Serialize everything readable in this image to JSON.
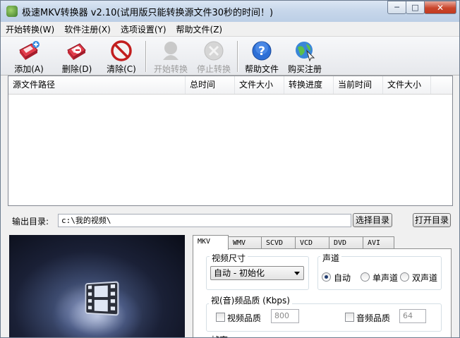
{
  "window": {
    "title": "极速MKV转换器 v2.10(试用版只能转换源文件30秒的时间！)",
    "min_glyph": "─",
    "max_glyph": "□",
    "close_glyph": "✕"
  },
  "menu": [
    "开始转换(W)",
    "软件注册(X)",
    "选项设置(Y)",
    "帮助文件(Z)"
  ],
  "toolbar": {
    "add": "添加(A)",
    "delete": "删除(D)",
    "clear": "清除(C)",
    "start": "开始转换",
    "stop": "停止转换",
    "help": "帮助文件",
    "buy": "购买注册"
  },
  "file_list": {
    "columns": [
      "源文件路径",
      "总时间",
      "文件大小",
      "转换进度",
      "当前时间",
      "文件大小"
    ]
  },
  "output": {
    "label": "输出目录:",
    "path": "c:\\我的视频\\",
    "select_btn": "选择目录",
    "open_btn": "打开目录"
  },
  "tabs": [
    "MKV",
    "WMV",
    "SCVD",
    "VCD",
    "DVD",
    "AVI"
  ],
  "settings": {
    "video_size_title": "视频尺寸",
    "video_size_value": "自动 - 初始化",
    "channel_title": "声道",
    "channel_options": [
      "自动",
      "单声道",
      "双声道"
    ],
    "quality_title": "视(音)频品质 (Kbps)",
    "video_quality_label": "视频品质",
    "video_quality_value": "800",
    "audio_quality_label": "音频品质",
    "audio_quality_value": "64",
    "framerate_title": "帧率"
  }
}
